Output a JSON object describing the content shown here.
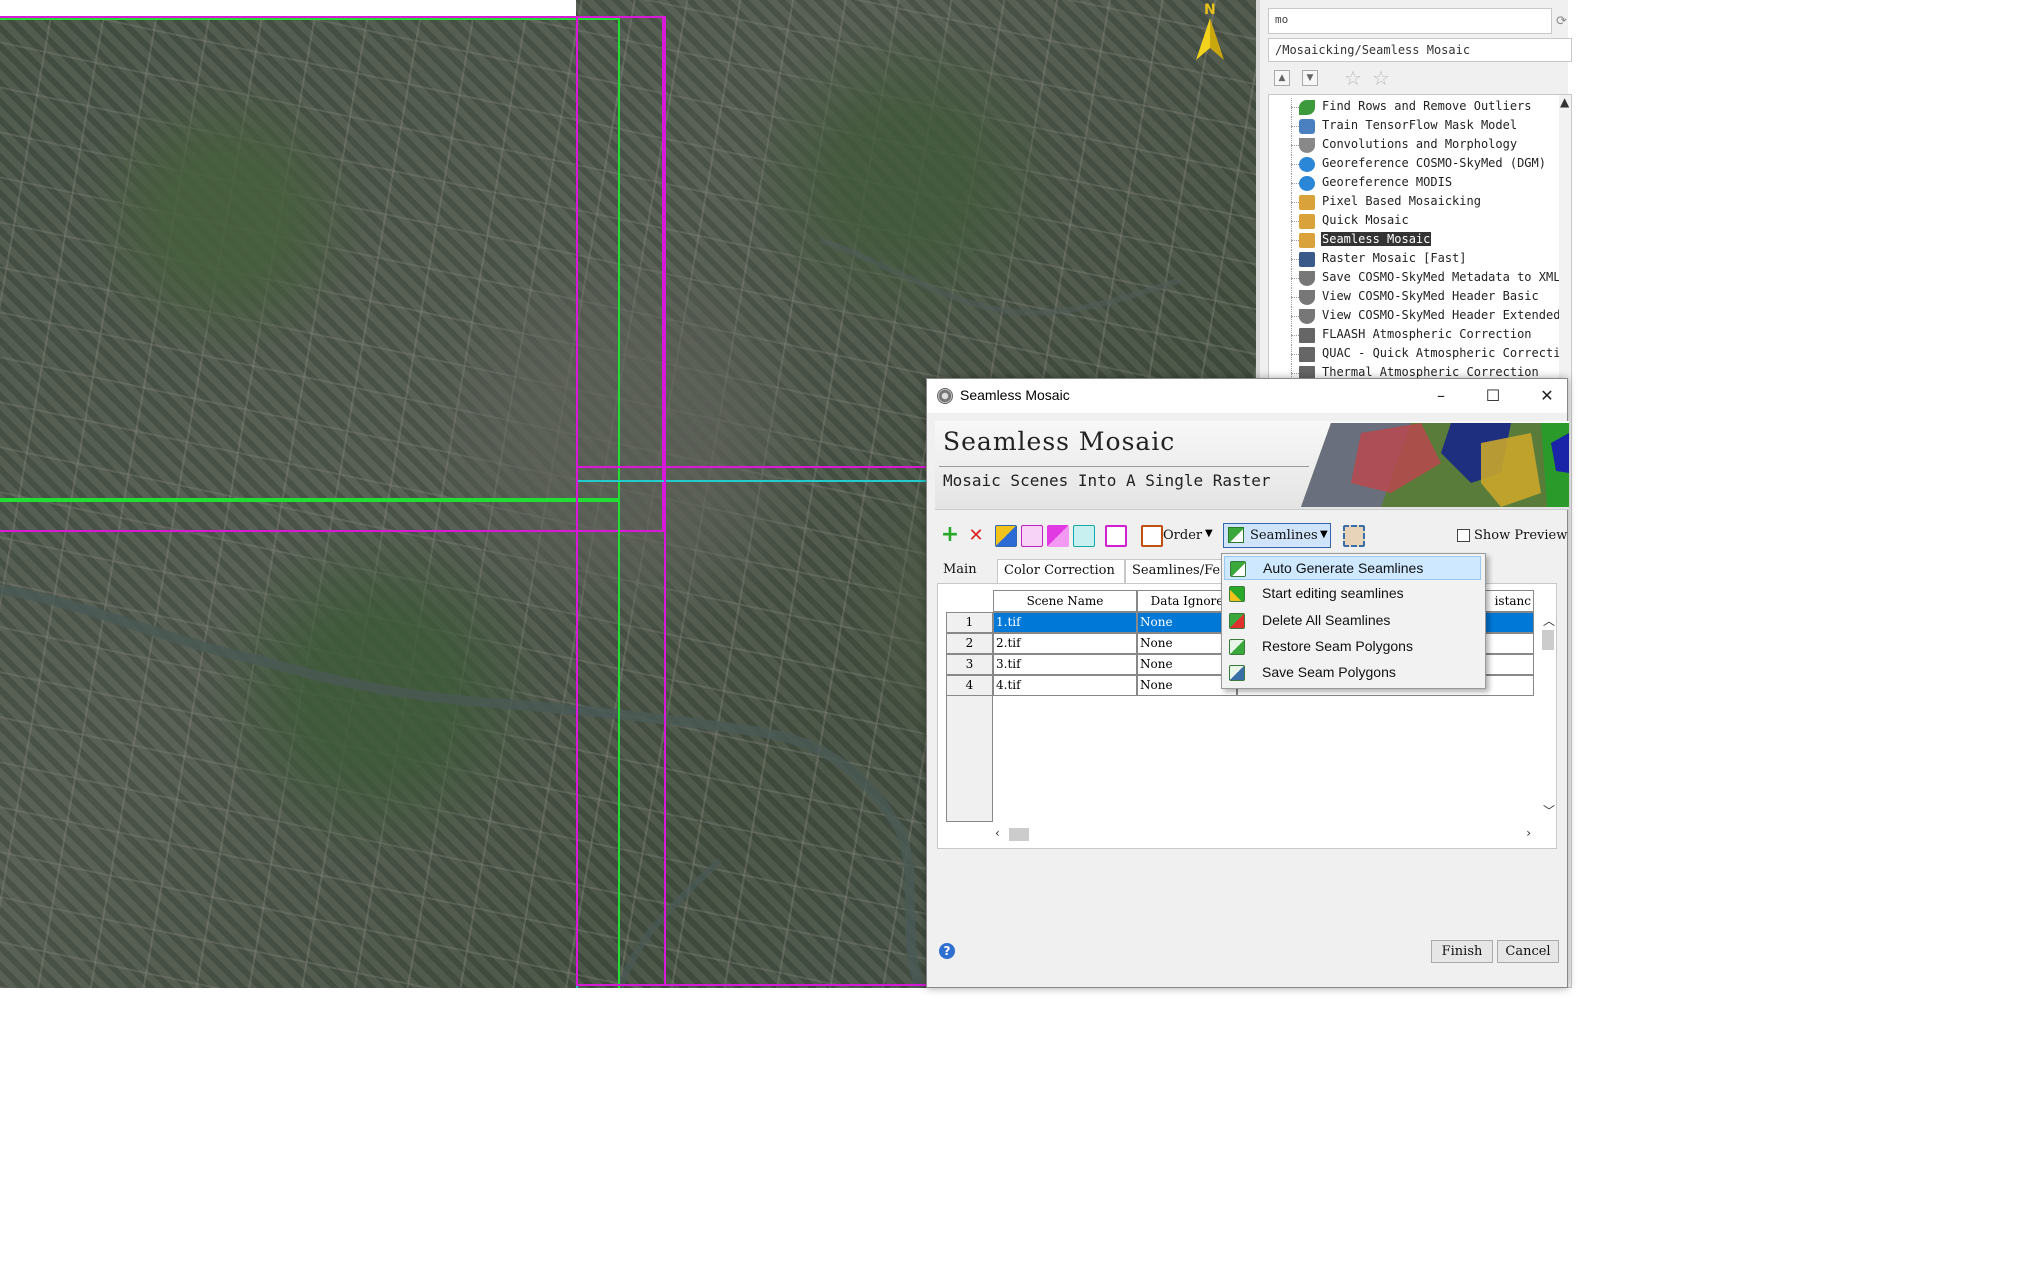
{
  "toolbox": {
    "search_value": "mo",
    "path": "/Mosaicking/Seamless Mosaic",
    "items": [
      {
        "label": "Find Rows and Remove Outliers",
        "icon": "leaf-icon",
        "color": "#3c9a3c"
      },
      {
        "label": "Train TensorFlow Mask Model",
        "icon": "network-icon",
        "color": "#4a7fc0"
      },
      {
        "label": "Convolutions and Morphology",
        "icon": "funnel-icon",
        "color": "#888888"
      },
      {
        "label": "Georeference COSMO-SkyMed (DGM)",
        "icon": "globe-icon",
        "color": "#2a86d6"
      },
      {
        "label": "Georeference MODIS",
        "icon": "globe-icon",
        "color": "#2a86d6"
      },
      {
        "label": "Pixel Based Mosaicking",
        "icon": "puzzle-icon",
        "color": "#d9a23a"
      },
      {
        "label": "Quick Mosaic",
        "icon": "puzzle-icon",
        "color": "#d9a23a"
      },
      {
        "label": "Seamless Mosaic",
        "icon": "puzzle-icon",
        "color": "#d9a23a",
        "selected": true
      },
      {
        "label": "Raster Mosaic [Fast]",
        "icon": "raster-icon",
        "color": "#3a5a8a"
      },
      {
        "label": "Save COSMO-SkyMed Metadata to XML",
        "icon": "satellite-dish-icon",
        "color": "#777777"
      },
      {
        "label": "View COSMO-SkyMed Header Basic",
        "icon": "satellite-dish-icon",
        "color": "#777777"
      },
      {
        "label": "View COSMO-SkyMed Header Extended",
        "icon": "satellite-dish-icon",
        "color": "#777777"
      },
      {
        "label": "FLAASH Atmospheric Correction",
        "icon": "binary-icon",
        "color": "#666666"
      },
      {
        "label": "QUAC - Quick Atmospheric Correcti",
        "icon": "binary-icon",
        "color": "#666666"
      },
      {
        "label": "Thermal Atmospheric Correction",
        "icon": "binary-icon",
        "color": "#666666"
      }
    ]
  },
  "map": {
    "north_label": "N"
  },
  "dialog": {
    "window_title": "Seamless Mosaic",
    "heading": "Seamless Mosaic",
    "subheading": "Mosaic Scenes Into A Single Raster",
    "toolbar": {
      "order_label": "Order",
      "seamlines_label": "Seamlines",
      "show_preview_label": "Show Preview",
      "show_preview_checked": false
    },
    "tabs": [
      "Main",
      "Color Correction",
      "Seamlines/Fe"
    ],
    "table": {
      "columns": [
        "Scene Name",
        "Data Ignore",
        "istanc"
      ],
      "rows": [
        {
          "num": "1",
          "scene": "1.tif",
          "ignore": "None",
          "selected": true
        },
        {
          "num": "2",
          "scene": "2.tif",
          "ignore": "None"
        },
        {
          "num": "3",
          "scene": "3.tif",
          "ignore": "None"
        },
        {
          "num": "4",
          "scene": "4.tif",
          "ignore": "None"
        }
      ]
    },
    "finish_label": "Finish",
    "cancel_label": "Cancel",
    "help_label": "?"
  },
  "seamlines_menu": {
    "items": [
      {
        "label": "Auto Generate Seamlines",
        "icon": "auto-seamline-icon",
        "highlighted": true
      },
      {
        "label": "Start editing seamlines",
        "icon": "edit-seamline-icon"
      },
      {
        "label": "Delete All Seamlines",
        "icon": "delete-seamline-icon"
      },
      {
        "label": "Restore Seam Polygons",
        "icon": "restore-polygon-icon"
      },
      {
        "label": "Save Seam Polygons",
        "icon": "save-polygon-icon"
      }
    ]
  },
  "colors": {
    "footprint_magenta": "#d81ad8",
    "footprint_green": "#22dd33",
    "footprint_cyan": "#22cccc",
    "selection_blue": "#0078d7",
    "menu_highlight": "#cde8ff"
  }
}
